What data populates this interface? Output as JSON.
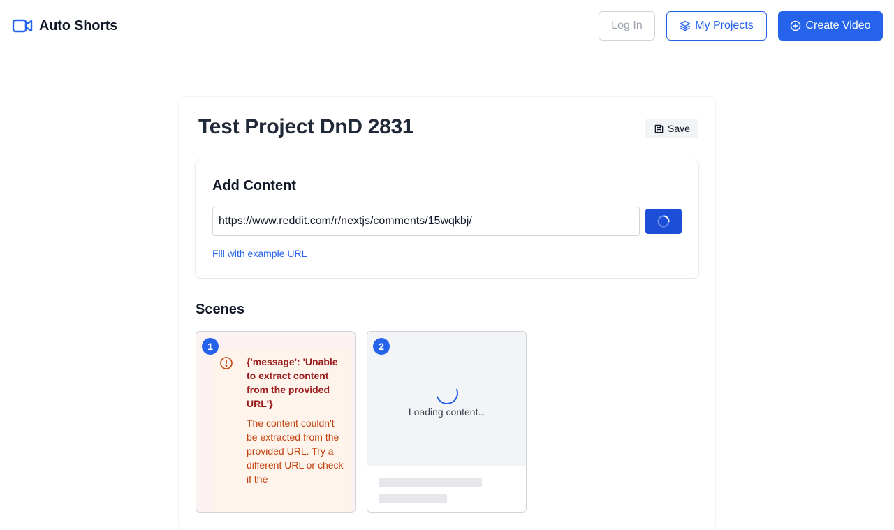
{
  "app": {
    "title": "Auto Shorts"
  },
  "header": {
    "login_label": "Log In",
    "my_projects_label": "My Projects",
    "create_video_label": "Create Video"
  },
  "project": {
    "title": "Test Project DnD 2831",
    "save_label": "Save"
  },
  "add_content": {
    "title": "Add Content",
    "url_value": "https://www.reddit.com/r/nextjs/comments/15wqkbj/",
    "example_link": "Fill with example URL"
  },
  "scenes": {
    "title": "Scenes",
    "items": [
      {
        "number": "1",
        "status": "error",
        "error_message": "{'message': 'Unable to extract content from the provided URL'}",
        "error_description": "The content couldn't be extracted from the provided URL. Try a different URL or check if the"
      },
      {
        "number": "2",
        "status": "loading",
        "loading_text": "Loading content..."
      }
    ]
  },
  "colors": {
    "primary": "#2563eb",
    "primary_dark": "#1d4ed8",
    "error_text": "#9b1c1c",
    "error_desc": "#c2410c",
    "error_bg": "#fdf2f2"
  },
  "icons": {
    "brand": "video-camera-icon",
    "my_projects": "layers-icon",
    "create_video": "plus-circle-icon",
    "save": "floppy-disk-icon",
    "submit": "spinner-icon",
    "error": "alert-circle-icon"
  }
}
